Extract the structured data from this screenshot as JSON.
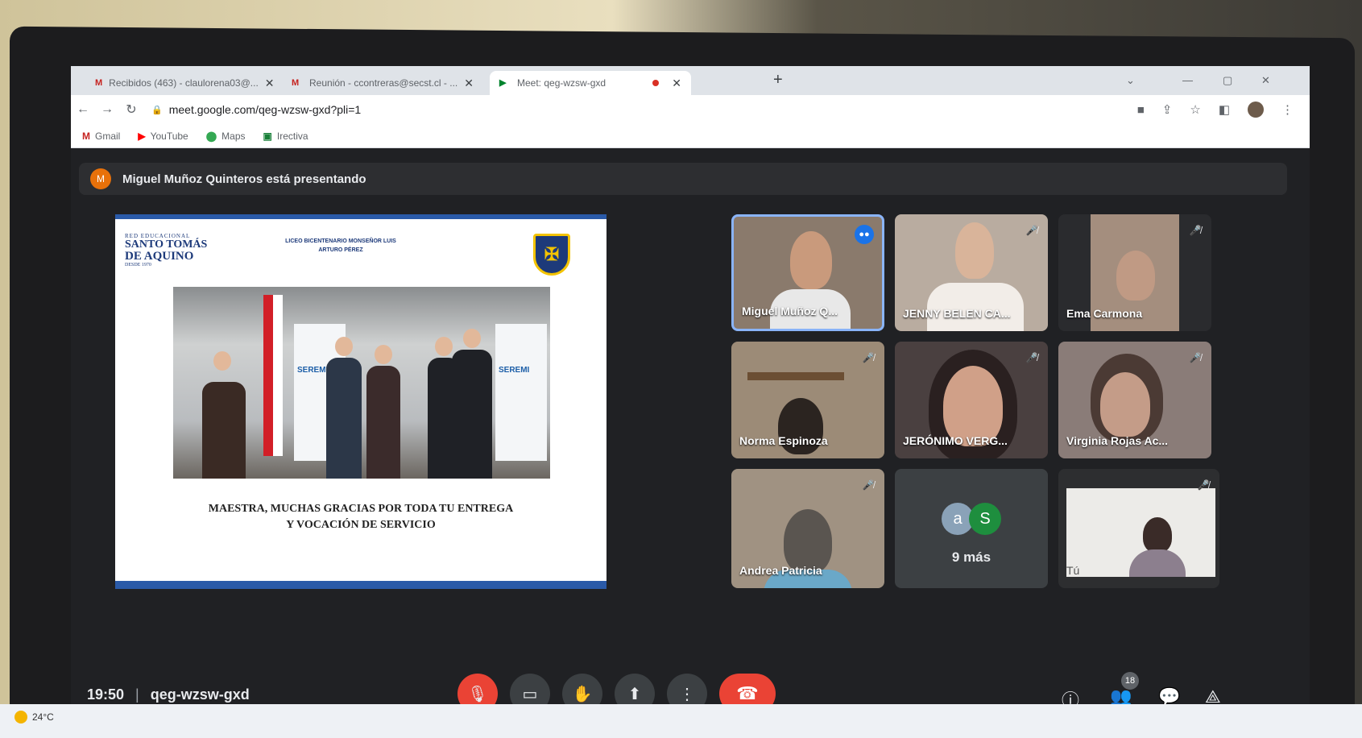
{
  "browser": {
    "tabs": [
      {
        "label": "Recibidos (463) - claulorena03@...",
        "icon": "gmail-icon"
      },
      {
        "label": "Reunión - ccontreras@secst.cl - ...",
        "icon": "gmail-icon"
      },
      {
        "label": "Meet: qeg-wzsw-gxd",
        "icon": "meet-icon",
        "active": true
      }
    ],
    "url": "meet.google.com/qeg-wzsw-gxd?pli=1",
    "bookmarks": [
      "Gmail",
      "YouTube",
      "Maps",
      "Irectiva"
    ]
  },
  "meet": {
    "presenting": "Miguel Muñoz Quinteros está presentando",
    "presenter_initial": "M",
    "slide": {
      "logo_line1": "RED EDUCACIONAL",
      "logo_line2": "SANTO TOMÁS",
      "logo_line3": "DE AQUINO",
      "logo_line4": "DESDE 1970",
      "school": "LICEO BICENTENARIO MONSEÑOR LUIS ARTURO PÉREZ",
      "banner_text": "SEREMI",
      "caption_line1": "MAESTRA, MUCHAS GRACIAS POR TODA TU ENTREGA",
      "caption_line2": "Y VOCACIÓN DE SERVICIO"
    },
    "participants": [
      {
        "name": "Miguel Muñoz Q...",
        "speaking": true
      },
      {
        "name": "JENNY BELEN CA...",
        "muted": true
      },
      {
        "name": "Ema Carmona",
        "muted": true
      },
      {
        "name": "Norma Espinoza",
        "muted": true
      },
      {
        "name": "JERÓNIMO VERG...",
        "muted": true
      },
      {
        "name": "Virginia Rojas Ac...",
        "muted": true
      },
      {
        "name": "Andrea Patricia",
        "muted": true
      },
      {
        "name": "Tú",
        "muted": true
      }
    ],
    "more_avatars": [
      "a",
      "S"
    ],
    "more_label": "9 más",
    "time": "19:50",
    "meeting_code": "qeg-wzsw-gxd",
    "participant_count": "18"
  },
  "taskbar": {
    "temperature": "24°C"
  },
  "colors": {
    "meet_bg": "#202124",
    "end_call": "#ea4335",
    "speaking_border": "#8ab4f8"
  }
}
